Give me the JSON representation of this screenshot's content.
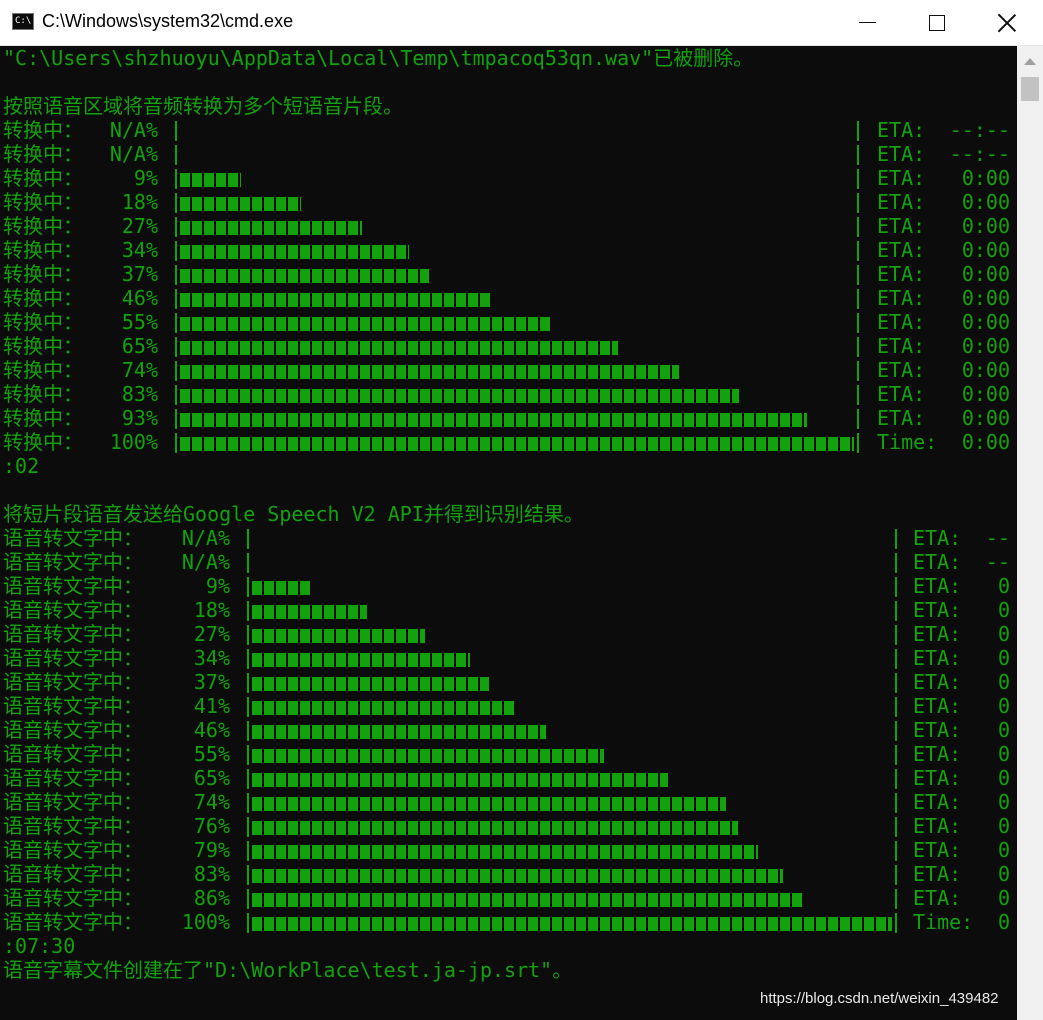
{
  "window": {
    "title": "C:\\Windows\\system32\\cmd.exe",
    "icon": "cmd-app-icon",
    "icon_text": "C:\\",
    "buttons": [
      "minimize-icon",
      "maximize-icon",
      "close-icon"
    ]
  },
  "colors": {
    "console_bg": "#0c0c0c",
    "console_text": "#13a10e",
    "titlebar_bg": "#ffffff",
    "scrollbar_bg": "#f0f0f0"
  },
  "console": {
    "deleted_msg": "\"C:\\Users\\shzhuoyu\\AppData\\Local\\Temp\\tmpacoq53qn.wav\"已被删除。",
    "section1_header": "按照语音区域将音频转换为多个短语音片段。",
    "section1": {
      "label": "转换中：",
      "rows": [
        {
          "percent": "N/A%",
          "fill": 0,
          "eta_label": "ETA:",
          "eta_value": "--:--"
        },
        {
          "percent": "N/A%",
          "fill": 0,
          "eta_label": "ETA:",
          "eta_value": "--:--"
        },
        {
          "percent": "9%",
          "fill": 0.09,
          "eta_label": "ETA:",
          "eta_value": "0:00"
        },
        {
          "percent": "18%",
          "fill": 0.18,
          "eta_label": "ETA:",
          "eta_value": "0:00"
        },
        {
          "percent": "27%",
          "fill": 0.27,
          "eta_label": "ETA:",
          "eta_value": "0:00"
        },
        {
          "percent": "34%",
          "fill": 0.34,
          "eta_label": "ETA:",
          "eta_value": "0:00"
        },
        {
          "percent": "37%",
          "fill": 0.37,
          "eta_label": "ETA:",
          "eta_value": "0:00"
        },
        {
          "percent": "46%",
          "fill": 0.46,
          "eta_label": "ETA:",
          "eta_value": "0:00"
        },
        {
          "percent": "55%",
          "fill": 0.55,
          "eta_label": "ETA:",
          "eta_value": "0:00"
        },
        {
          "percent": "65%",
          "fill": 0.65,
          "eta_label": "ETA:",
          "eta_value": "0:00"
        },
        {
          "percent": "74%",
          "fill": 0.74,
          "eta_label": "ETA:",
          "eta_value": "0:00"
        },
        {
          "percent": "83%",
          "fill": 0.83,
          "eta_label": "ETA:",
          "eta_value": "0:00"
        },
        {
          "percent": "93%",
          "fill": 0.93,
          "eta_label": "ETA:",
          "eta_value": "0:00"
        },
        {
          "percent": "100%",
          "fill": 1.0,
          "eta_label": "Time:",
          "eta_value": "0:00"
        }
      ],
      "time_tail": ":02"
    },
    "section2_header": "将短片段语音发送给Google Speech V2 API并得到识别结果。",
    "section2": {
      "label": "语音转文字中：",
      "rows": [
        {
          "percent": "N/A%",
          "fill": 0,
          "eta_label": "ETA:",
          "eta_value": "--"
        },
        {
          "percent": "N/A%",
          "fill": 0,
          "eta_label": "ETA:",
          "eta_value": "--"
        },
        {
          "percent": "9%",
          "fill": 0.09,
          "eta_label": "ETA:",
          "eta_value": "0"
        },
        {
          "percent": "18%",
          "fill": 0.18,
          "eta_label": "ETA:",
          "eta_value": "0"
        },
        {
          "percent": "27%",
          "fill": 0.27,
          "eta_label": "ETA:",
          "eta_value": "0"
        },
        {
          "percent": "34%",
          "fill": 0.34,
          "eta_label": "ETA:",
          "eta_value": "0"
        },
        {
          "percent": "37%",
          "fill": 0.37,
          "eta_label": "ETA:",
          "eta_value": "0"
        },
        {
          "percent": "41%",
          "fill": 0.41,
          "eta_label": "ETA:",
          "eta_value": "0"
        },
        {
          "percent": "46%",
          "fill": 0.46,
          "eta_label": "ETA:",
          "eta_value": "0"
        },
        {
          "percent": "55%",
          "fill": 0.55,
          "eta_label": "ETA:",
          "eta_value": "0"
        },
        {
          "percent": "65%",
          "fill": 0.65,
          "eta_label": "ETA:",
          "eta_value": "0"
        },
        {
          "percent": "74%",
          "fill": 0.74,
          "eta_label": "ETA:",
          "eta_value": "0"
        },
        {
          "percent": "76%",
          "fill": 0.76,
          "eta_label": "ETA:",
          "eta_value": "0"
        },
        {
          "percent": "79%",
          "fill": 0.79,
          "eta_label": "ETA:",
          "eta_value": "0"
        },
        {
          "percent": "83%",
          "fill": 0.83,
          "eta_label": "ETA:",
          "eta_value": "0"
        },
        {
          "percent": "86%",
          "fill": 0.86,
          "eta_label": "ETA:",
          "eta_value": "0"
        },
        {
          "percent": "100%",
          "fill": 1.0,
          "eta_label": "Time:",
          "eta_value": "0"
        }
      ],
      "time_tail": ":07:30"
    },
    "final_msg": "语音字幕文件创建在了\"D:\\WorkPlace\\test.ja-jp.srt\"。"
  },
  "watermark": "https://blog.csdn.net/weixin_439482"
}
